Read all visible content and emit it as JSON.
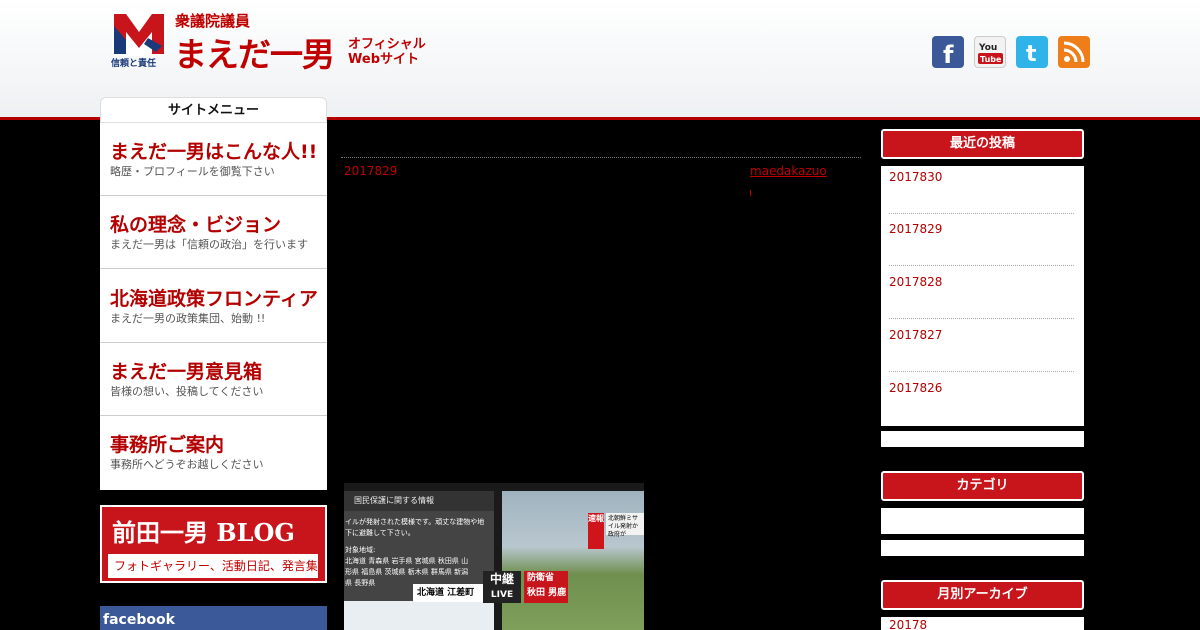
{
  "header": {
    "logo_caption": "信頼と責任",
    "rank": "衆議院議員",
    "name": "まえだ一男",
    "site_line1": "オフィシャル",
    "site_line2": "Webサイト",
    "social": [
      "facebook-icon",
      "youtube-icon",
      "twitter-icon",
      "rss-icon"
    ],
    "youtube_label": "You Tube"
  },
  "sidebar": {
    "menu_title": "サイトメニュー",
    "items": [
      {
        "title": "まえだ一男はこんな人!!",
        "sub": "略歴・プロフィールを御覧下さい"
      },
      {
        "title": "私の理念・ビジョン",
        "sub": "まえだ一男は「信頼の政治」を行います"
      },
      {
        "title": "北海道政策フロンティア",
        "sub": "まえだ一男の政策集団、始動 !!"
      },
      {
        "title": "まえだ一男意見箱",
        "sub": "皆様の想い、投稿してください"
      },
      {
        "title": "事務所ご案内",
        "sub": "事務所へどうぞお越しください"
      }
    ],
    "blog_title": "前田一男 BLOG",
    "blog_sub": "フォトギャラリー、活動日記、発言集",
    "facebook_label": "facebook"
  },
  "post": {
    "date": "2017829",
    "author": "maedakazuo"
  },
  "tv": {
    "header": "国民保護に関する情報",
    "text_lines": [
      "イルが発射された模様です。頑丈な建物や地",
      "下に避難して下さい。",
      "",
      "対象地域:",
      "北海道 青森県 岩手県 宮城県 秋田県 山",
      "形県 福島県 茨城県 栃木県 群馬県 新潟",
      "県 長野県"
    ],
    "badge": "速報",
    "news": "北朝鮮ミサイル発射か 政府が",
    "location": "北海道 江差町",
    "live_line1": "中継",
    "live_line2": "LIVE",
    "ministry_line1": "防衛省",
    "ministry_line2": "秋田 男鹿"
  },
  "right": {
    "recent_title": "最近の投稿",
    "recent": [
      "2017830",
      "2017829",
      "2017828",
      "2017827",
      "2017826"
    ],
    "category_title": "カテゴリ",
    "archive_title": "月別アーカイブ",
    "archive_first": "20178"
  },
  "colors": {
    "accent": "#c8141b",
    "facebook": "#3b5998",
    "twitter": "#2fb3e8",
    "rss": "#ef7d1a"
  }
}
